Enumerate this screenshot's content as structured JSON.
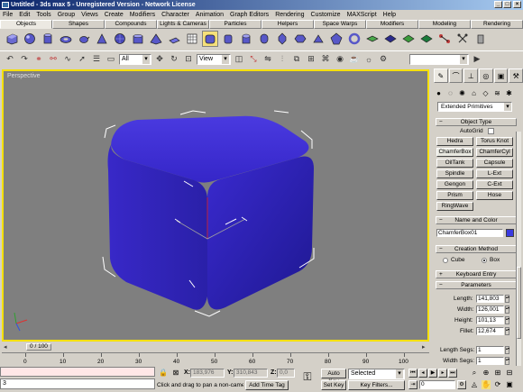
{
  "window": {
    "title": "Untitled - 3ds max 5 - Unregistered Version - Network License"
  },
  "menu": [
    "File",
    "Edit",
    "Tools",
    "Group",
    "Views",
    "Create",
    "Modifiers",
    "Character",
    "Animation",
    "Graph Editors",
    "Rendering",
    "Customize",
    "MAXScript",
    "Help"
  ],
  "tabs": [
    "Objects",
    "Shapes",
    "Compounds",
    "Lights & Cameras",
    "Particles",
    "Helpers",
    "Space Warps",
    "Modifiers",
    "Modeling",
    "Rendering"
  ],
  "active_tab": "Objects",
  "toolbar": {
    "selection_filter": "All",
    "ref_coord": "View"
  },
  "viewport": {
    "label": "Perspective"
  },
  "command_panel": {
    "category": "Extended Primitives",
    "object_type_title": "Object Type",
    "autogrid_label": "AutoGrid",
    "buttons": [
      "Hedra",
      "Torus Knot",
      "ChamferBox",
      "ChamferCyl",
      "OilTank",
      "Capsule",
      "Spindle",
      "L-Ext",
      "Gengon",
      "C-Ext",
      "Prism",
      "Hose",
      "RingWave"
    ],
    "name_color_title": "Name and Color",
    "object_name": "ChamferBox01",
    "object_color": "#3a3ae0",
    "creation_method_title": "Creation Method",
    "creation_cube": "Cube",
    "creation_box": "Box",
    "keyboard_entry_title": "Keyboard Entry",
    "parameters_title": "Parameters",
    "params": [
      {
        "label": "Length:",
        "value": "141,803"
      },
      {
        "label": "Width:",
        "value": "126,001"
      },
      {
        "label": "Height:",
        "value": "101,13"
      },
      {
        "label": "Fillet:",
        "value": "12,674"
      }
    ],
    "segs": [
      {
        "label": "Length Segs:",
        "value": "1"
      },
      {
        "label": "Width Segs:",
        "value": "1"
      }
    ]
  },
  "timeline": {
    "slider_label": "0 / 100",
    "ticks": [
      "0",
      "10",
      "20",
      "30",
      "40",
      "50",
      "60",
      "70",
      "80",
      "90",
      "100"
    ]
  },
  "status": {
    "listener_value": "3",
    "x_label": "X:",
    "x_value": "183,976",
    "y_label": "Y:",
    "y_value": "310,843",
    "z_label": "Z:",
    "z_value": "0,0",
    "prompt": "Click and drag to pan a non-camera view",
    "add_time_tag": "Add Time Tag",
    "auto_key": "Auto Key",
    "set_key": "Set Key",
    "selected": "Selected",
    "key_filters": "Key Filters...",
    "frame": "0"
  }
}
